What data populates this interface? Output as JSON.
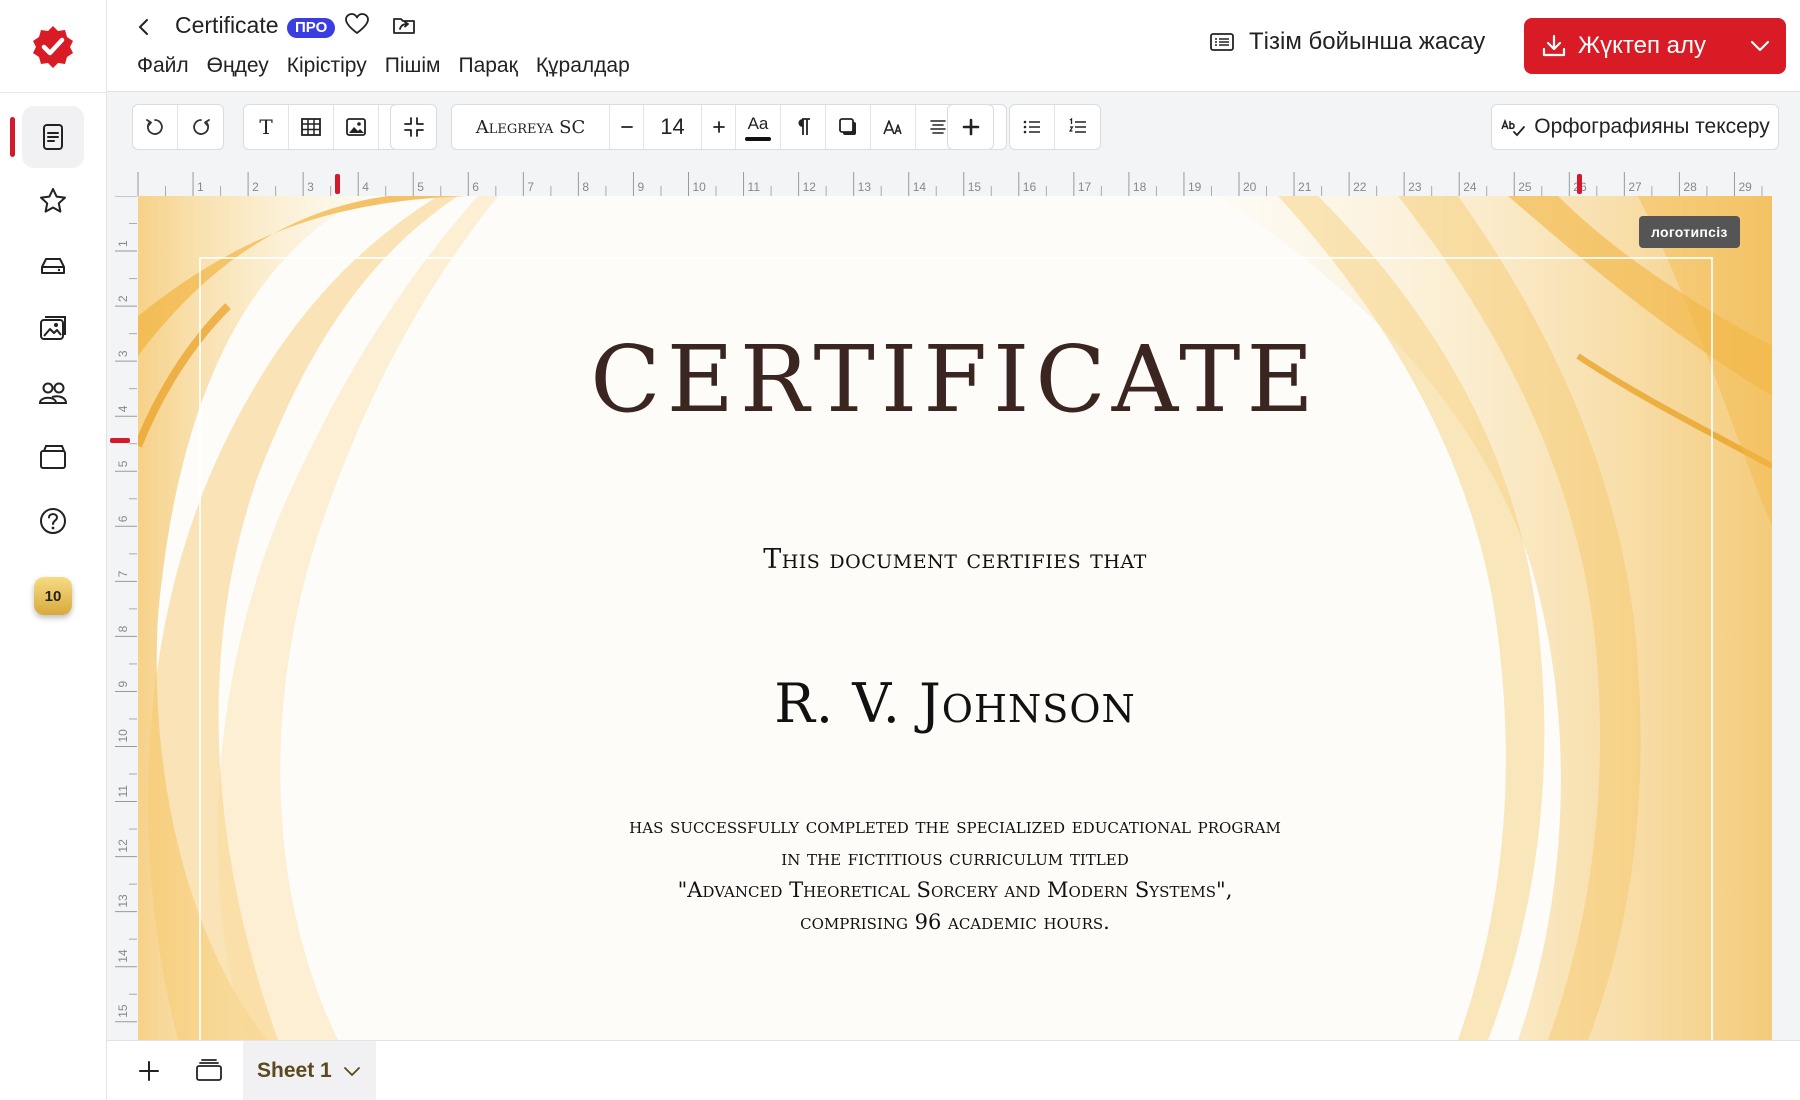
{
  "header": {
    "doc_title": "Certificate",
    "pro_badge": "ПРО",
    "menu": [
      "Файл",
      "Өңдеу",
      "Кірістіру",
      "Пішім",
      "Парақ",
      "Құралдар"
    ],
    "list_create_label": "Тізім бойынша жасау",
    "download_label": "Жүктеп алу"
  },
  "sidebar": {
    "badge_count": "10",
    "items": [
      "document-icon",
      "star-icon",
      "drive-icon",
      "images-icon",
      "users-icon",
      "folder-icon",
      "help-icon"
    ]
  },
  "toolbar": {
    "font_name": "Alegreya SC",
    "font_size": "14",
    "text_tool": "T",
    "case_label": "Aa",
    "spellcheck_label": "Орфографияны тексеру"
  },
  "ruler": {
    "top_labels": [
      "1",
      "2",
      "3",
      "4",
      "5",
      "6",
      "7",
      "8",
      "9",
      "10",
      "11",
      "12",
      "13",
      "14",
      "15",
      "16",
      "17",
      "18",
      "19",
      "20",
      "21",
      "22",
      "23",
      "24",
      "25",
      "26",
      "27",
      "28",
      "29"
    ],
    "left_labels": [
      "1",
      "2",
      "3",
      "4",
      "5",
      "6",
      "7",
      "8",
      "9",
      "10",
      "11",
      "12",
      "13",
      "14",
      "15"
    ]
  },
  "canvas": {
    "no_logo_label": "логотипсіз",
    "title": "CERTIFICATE",
    "subtitle": "This document certifies that",
    "recipient": "R. V. Johnson",
    "body": [
      "has successfully completed the specialized educational program",
      "in the fictitious curriculum titled",
      "\"Advanced Theoretical Sorcery and Modern Systems\",",
      "comprising 96 academic hours."
    ]
  },
  "bottom": {
    "sheet_label": "Sheet 1"
  },
  "colors": {
    "accent": "#d81b25",
    "pro": "#3a3ee0",
    "title": "#3b2521"
  }
}
